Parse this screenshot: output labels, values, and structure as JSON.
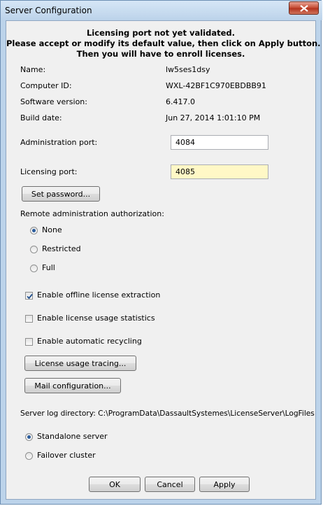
{
  "window": {
    "title": "Server Configuration"
  },
  "notice": {
    "line1": "Licensing port not yet validated.",
    "line2": "Please accept or modify its default value, then click on Apply button.",
    "line3": "Then you will have to enroll licenses."
  },
  "info": [
    {
      "label": "Name:",
      "value": "lw5ses1dsy"
    },
    {
      "label": "Computer ID:",
      "value": "WXL-42BF1C970EBDBB91"
    },
    {
      "label": "Software version:",
      "value": "6.417.0"
    },
    {
      "label": "Build date:",
      "value": "Jun 27, 2014 1:01:10 PM"
    }
  ],
  "admin_port": {
    "label": "Administration port:",
    "value": "4084"
  },
  "licensing_port": {
    "label": "Licensing port:",
    "value": "4085"
  },
  "set_password_label": "Set password...",
  "remote_admin": {
    "label": "Remote administration authorization:",
    "options": [
      {
        "label": "None",
        "selected": true
      },
      {
        "label": "Restricted",
        "selected": false
      },
      {
        "label": "Full",
        "selected": false
      }
    ]
  },
  "checkboxes": [
    {
      "label": "Enable offline license extraction",
      "checked": true
    },
    {
      "label": "Enable license usage statistics",
      "checked": false
    },
    {
      "label": "Enable automatic recycling",
      "checked": false
    }
  ],
  "license_tracing_label": "License usage tracing...",
  "mail_config_label": "Mail configuration...",
  "log_dir_text": "Server log directory: C:\\ProgramData\\DassaultSystemes\\LicenseServer\\LogFiles",
  "server_mode": {
    "options": [
      {
        "label": "Standalone server",
        "selected": true
      },
      {
        "label": "Failover cluster",
        "selected": false
      }
    ]
  },
  "buttons": {
    "ok": "OK",
    "cancel": "Cancel",
    "apply": "Apply"
  }
}
